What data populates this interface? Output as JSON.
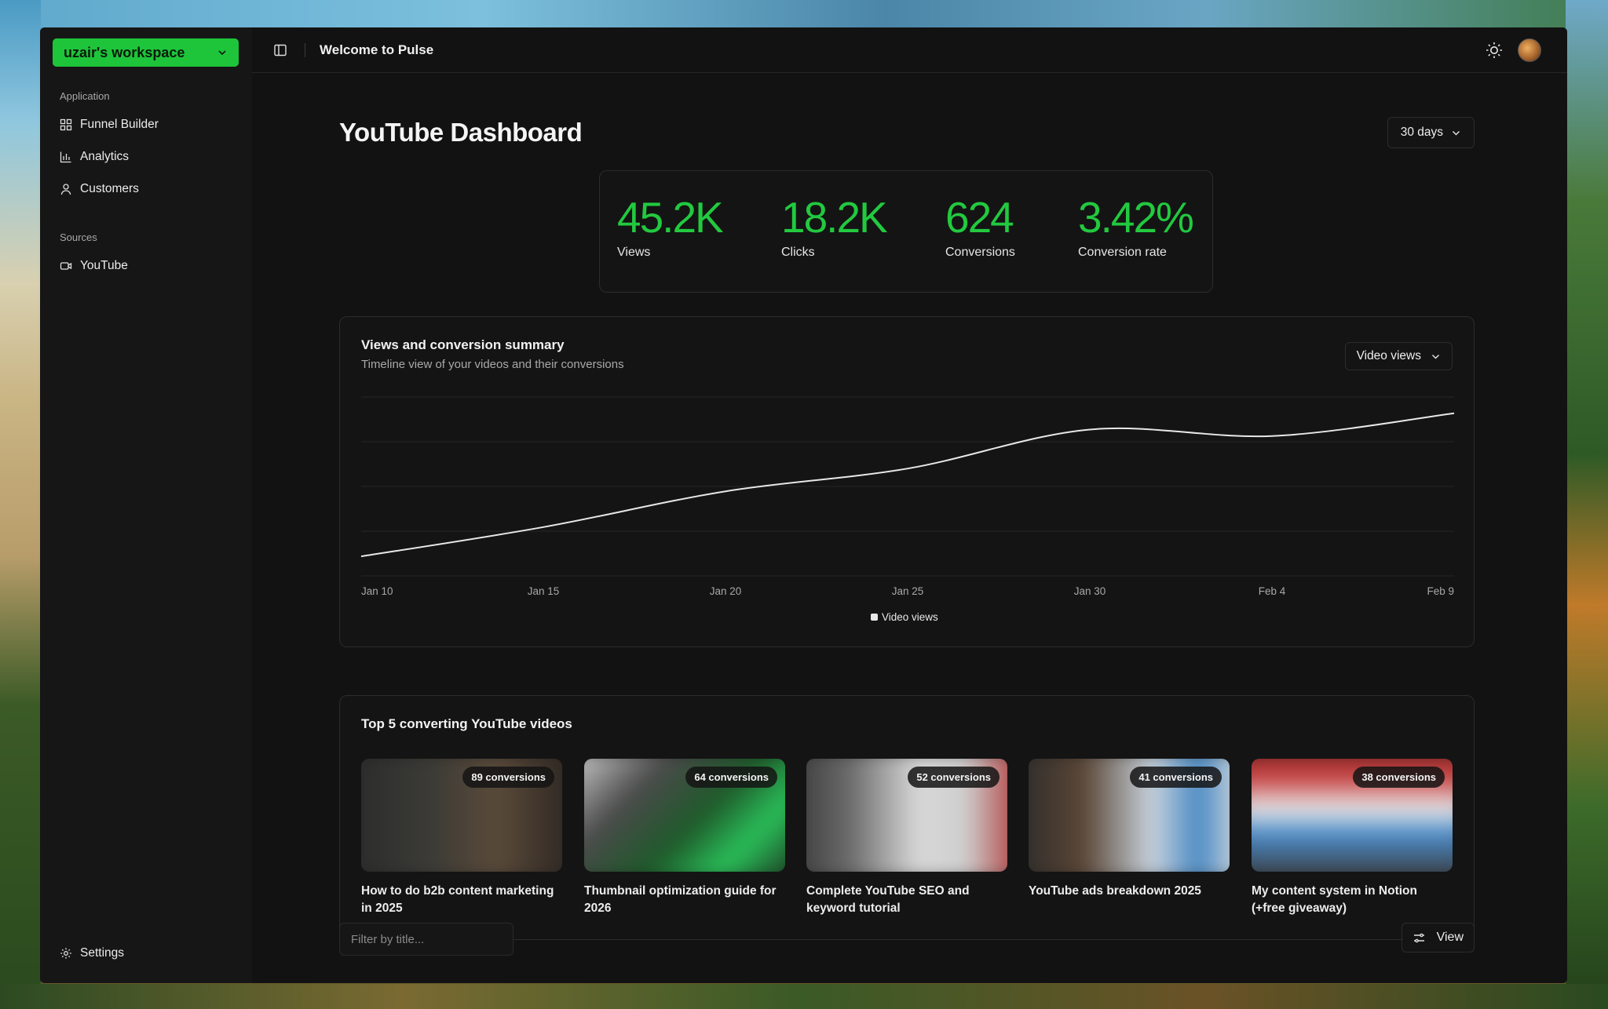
{
  "sidebar": {
    "workspace": "uzair's workspace",
    "groups": [
      {
        "label": "Application",
        "items": [
          {
            "label": "Funnel Builder",
            "icon": "grid-icon"
          },
          {
            "label": "Analytics",
            "icon": "bar-chart-icon"
          },
          {
            "label": "Customers",
            "icon": "user-icon"
          }
        ]
      },
      {
        "label": "Sources",
        "items": [
          {
            "label": "YouTube",
            "icon": "video-icon"
          }
        ]
      }
    ],
    "settings": "Settings"
  },
  "topbar": {
    "title": "Welcome to Pulse"
  },
  "page": {
    "title": "YouTube Dashboard",
    "range": "30 days"
  },
  "stats": [
    {
      "value": "45.2K",
      "label": "Views"
    },
    {
      "value": "18.2K",
      "label": "Clicks"
    },
    {
      "value": "624",
      "label": "Conversions"
    },
    {
      "value": "3.42%",
      "label": "Conversion rate"
    }
  ],
  "summary": {
    "title": "Views and conversion summary",
    "subtitle": "Timeline view of your videos and their conversions",
    "series_select": "Video views"
  },
  "chart_data": {
    "type": "line",
    "x": [
      "Jan 10",
      "Jan 15",
      "Jan 20",
      "Jan 25",
      "Jan 30",
      "Feb 4",
      "Feb 9"
    ],
    "series": [
      {
        "name": "Video views",
        "values": [
          0.6,
          1.5,
          2.6,
          3.3,
          4.5,
          4.3,
          5.0
        ]
      }
    ],
    "grid": true,
    "legend": "bottom-center",
    "colors": {
      "line": "#e8e8e8",
      "grid": "#262626"
    }
  },
  "top_videos": {
    "title": "Top 5 converting YouTube videos",
    "items": [
      {
        "badge": "89 conversions",
        "title": "How to do b2b content marketing in 2025"
      },
      {
        "badge": "64 conversions",
        "title": "Thumbnail optimization guide for 2026"
      },
      {
        "badge": "52 conversions",
        "title": "Complete YouTube SEO and keyword tutorial"
      },
      {
        "badge": "41 conversions",
        "title": "YouTube ads breakdown 2025"
      },
      {
        "badge": "38 conversions",
        "title": "My content system in Notion (+free giveaway)"
      }
    ]
  },
  "table": {
    "filter_placeholder": "Filter by title...",
    "view_label": "View"
  },
  "colors": {
    "accent": "#22c93f",
    "background": "#121212",
    "card": "#141414",
    "border": "#2c2c2c"
  }
}
